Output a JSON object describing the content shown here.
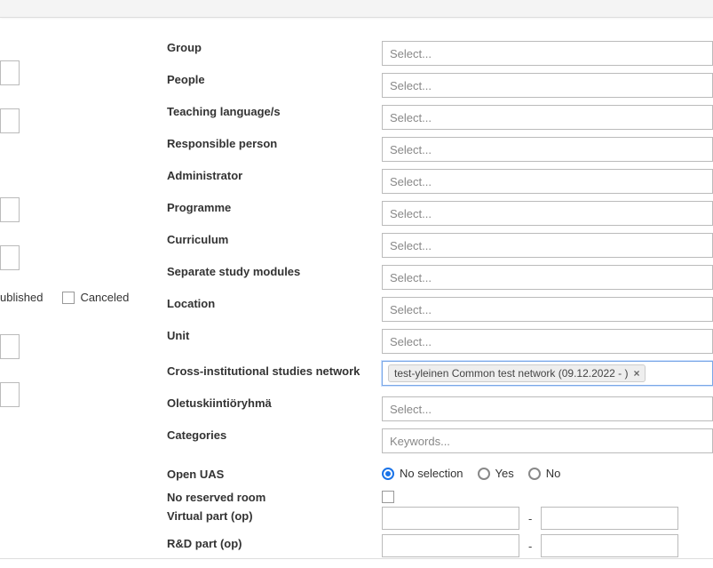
{
  "labels": {
    "group": "Group",
    "people": "People",
    "teaching_language": "Teaching language/s",
    "responsible_person": "Responsible person",
    "administrator": "Administrator",
    "programme": "Programme",
    "curriculum": "Curriculum",
    "separate_study_modules": "Separate study modules",
    "location": "Location",
    "unit": "Unit",
    "cross_institutional": "Cross-institutional studies network",
    "oletuskiintioryhma": "Oletuskiintiöryhmä",
    "categories": "Categories",
    "open_uas": "Open UAS",
    "no_reserved_room": "No reserved room",
    "virtual_part": "Virtual part (op)",
    "rd_part": "R&D part (op)"
  },
  "left_checks": {
    "published_partial": "ublished",
    "canceled": "Canceled"
  },
  "placeholders": {
    "select": "Select...",
    "keywords": "Keywords..."
  },
  "chips": {
    "cross_network": "test-yleinen Common test network (09.12.2022 - )"
  },
  "radio": {
    "no_selection": "No selection",
    "yes": "Yes",
    "no": "No"
  }
}
